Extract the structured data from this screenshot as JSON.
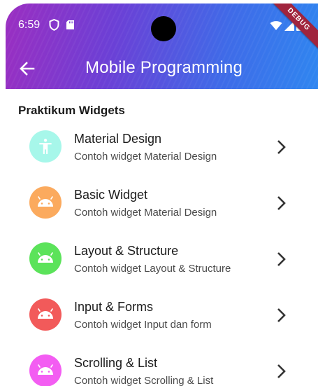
{
  "status_bar": {
    "time": "6:59",
    "icons": [
      "shield-icon",
      "sd-card-icon",
      "wifi-icon",
      "signal-icon",
      "battery-icon"
    ]
  },
  "debug_banner": "DEBUG",
  "app_bar": {
    "title": "Mobile Programming",
    "back_icon": "arrow-back-icon"
  },
  "section": {
    "title": "Praktikum Widgets"
  },
  "items": [
    {
      "title": "Material Design",
      "subtitle": "Contoh widget Material Design",
      "icon": "accessibility-icon",
      "color": "#a7f7ea"
    },
    {
      "title": "Basic Widget",
      "subtitle": "Contoh widget Material Design",
      "icon": "android-icon",
      "color": "#fbaa5e"
    },
    {
      "title": "Layout & Structure",
      "subtitle": "Contoh widget Layout & Structure",
      "icon": "android-icon",
      "color": "#5be35a"
    },
    {
      "title": "Input & Forms",
      "subtitle": "Contoh widget Input dan form",
      "icon": "android-icon",
      "color": "#f25a5a"
    },
    {
      "title": "Scrolling & List",
      "subtitle": "Contoh widget Scrolling & List",
      "icon": "android-icon",
      "color": "#f35df2"
    }
  ],
  "colors": {
    "gradient_start": "#9b2ec1",
    "gradient_end": "#2f86f0",
    "debug": "#a0243d"
  }
}
